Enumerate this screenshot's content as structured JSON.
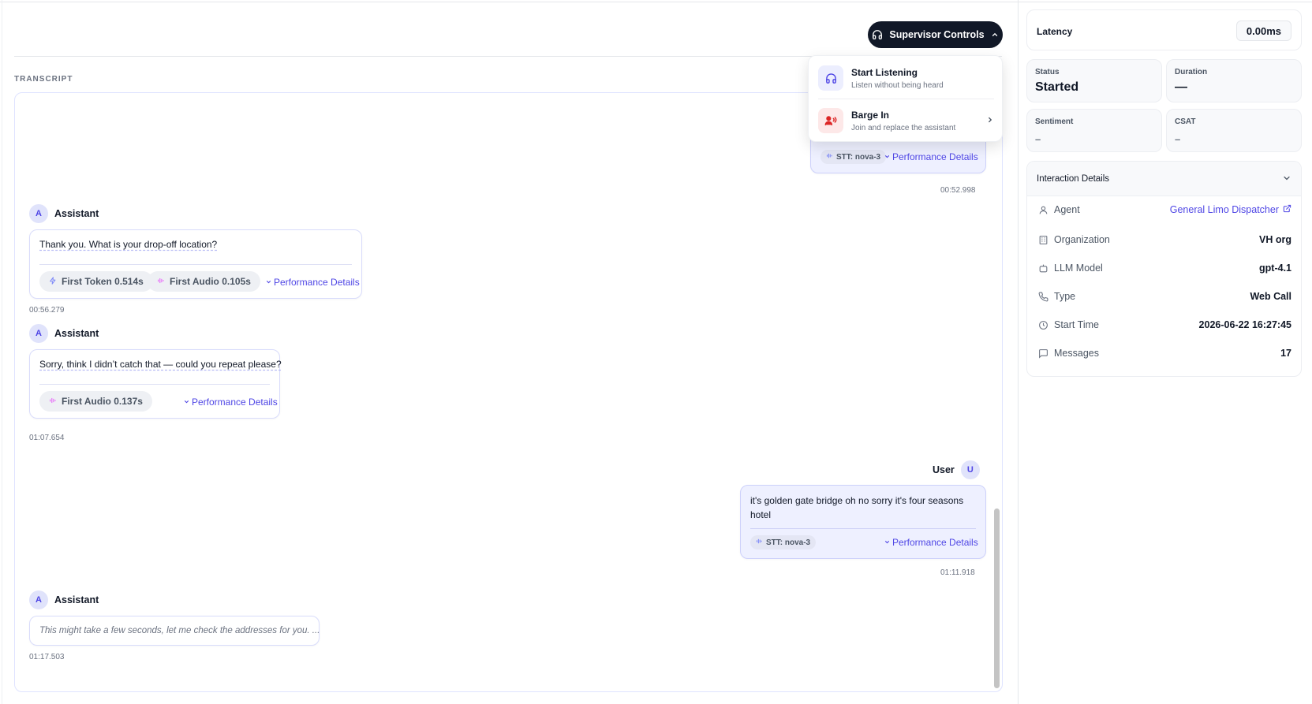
{
  "header": {
    "supervisor_button": "Supervisor Controls",
    "transcript_label": "TRANSCRIPT"
  },
  "dropdown": {
    "items": [
      {
        "title": "Start Listening",
        "subtitle": "Listen without being heard",
        "icon": "headphones-icon"
      },
      {
        "title": "Barge In",
        "subtitle": "Join and replace the assistant",
        "icon": "barge-in-icon"
      }
    ]
  },
  "messages": [
    {
      "role": "User",
      "stt": "STT: nova-3",
      "perf": "Performance Details",
      "time": "00:52.998"
    },
    {
      "role": "Assistant",
      "avatar": "A",
      "text": "Thank you. What is your drop-off location?",
      "chips": [
        "First Token 0.514s",
        "First Audio 0.105s"
      ],
      "perf": "Performance Details",
      "time": "00:56.279"
    },
    {
      "role": "Assistant",
      "avatar": "A",
      "text": "Sorry, think I didn’t catch that — could you repeat please?",
      "chips": [
        "First Audio 0.137s"
      ],
      "perf": "Performance Details",
      "time": "01:07.654"
    },
    {
      "role": "User",
      "avatar": "U",
      "text": "it's golden gate bridge oh no sorry it's four seasons hotel",
      "stt": "STT: nova-3",
      "perf": "Performance Details",
      "time": "01:11.918"
    },
    {
      "role": "Assistant",
      "avatar": "A",
      "text": "This might take a few seconds, let me check the addresses for you. ...",
      "time": "01:17.503"
    }
  ],
  "sidebar": {
    "latency_label": "Latency",
    "latency_value": "0.00ms",
    "status_label": "Status",
    "status_value": "Started",
    "duration_label": "Duration",
    "duration_value": "—",
    "sentiment_label": "Sentiment",
    "sentiment_value": "–",
    "csat_label": "CSAT",
    "csat_value": "–",
    "interaction_title": "Interaction Details",
    "details": [
      {
        "label": "Agent",
        "value": "General Limo Dispatcher",
        "icon": "user-icon"
      },
      {
        "label": "Organization",
        "value": "VH org",
        "icon": "building-icon"
      },
      {
        "label": "LLM Model",
        "value": "gpt-4.1",
        "icon": "bot-icon"
      },
      {
        "label": "Type",
        "value": "Web Call",
        "icon": "phone-icon"
      },
      {
        "label": "Start Time",
        "value": "2026-06-22 16:27:45",
        "icon": "clock-icon"
      },
      {
        "label": "Messages",
        "value": "17",
        "icon": "message-icon"
      }
    ]
  },
  "colors": {
    "accent": "#4f46e5",
    "dark_button": "#111827",
    "user_bubble": "#eef0ff",
    "barge_in": "#dc2626"
  }
}
